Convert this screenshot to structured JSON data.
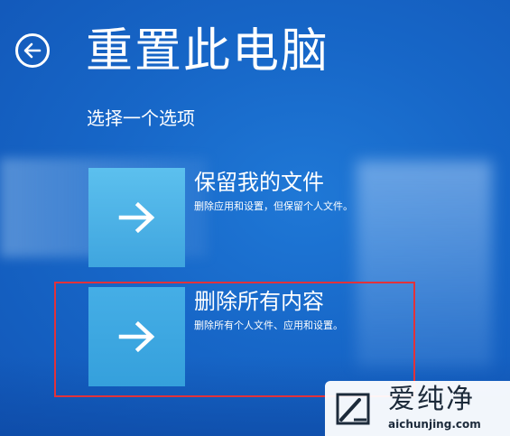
{
  "header": {
    "title": "重置此电脑",
    "subtitle": "选择一个选项",
    "back_icon": "back-arrow-icon"
  },
  "options": [
    {
      "title": "保留我的文件",
      "description": "删除应用和设置，但保留个人文件。",
      "icon": "arrow-right-icon"
    },
    {
      "title": "删除所有内容",
      "description": "删除所有个人文件、应用和设置。",
      "icon": "arrow-right-icon"
    }
  ],
  "highlight": {
    "color": "#e2323a"
  },
  "watermark": {
    "name": "爱纯净",
    "url": "aichunjing.com"
  },
  "colors": {
    "background": "#1767c8",
    "tile": "#4fb3e6",
    "text": "#ffffff"
  }
}
